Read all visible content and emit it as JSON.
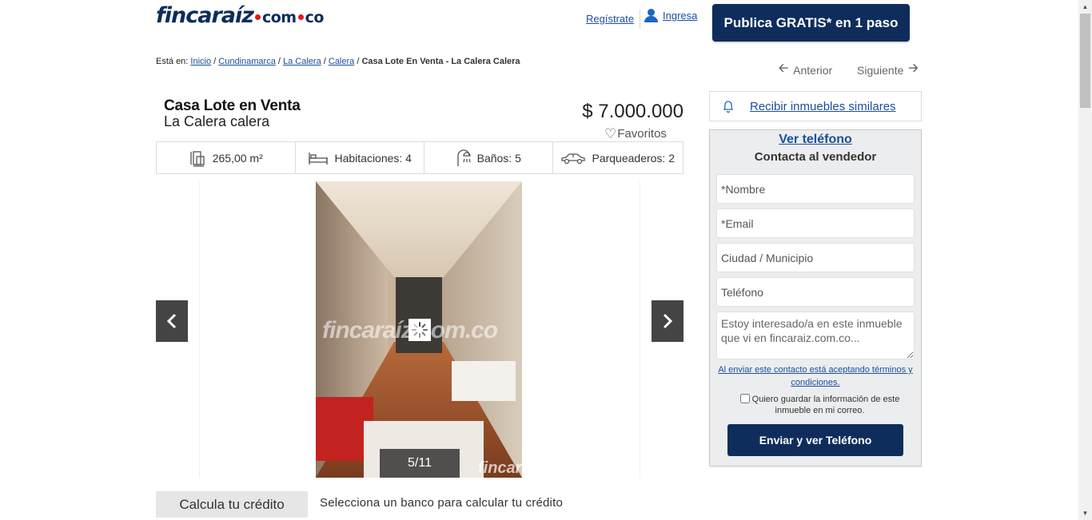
{
  "header": {
    "logo_main": "fincaraíz",
    "logo_com": "com",
    "logo_co": "co",
    "register": "Regístrate",
    "login": "Ingresa",
    "publish": "Publica GRATIS* en 1 paso"
  },
  "breadcrumb": {
    "prefix": "Está en:",
    "items": [
      "Inicio",
      "Cundinamarca",
      "La Calera",
      "Calera"
    ],
    "current": "Casa Lote En Venta - La Calera Calera"
  },
  "nav": {
    "prev": "Anterior",
    "next": "Siguiente"
  },
  "listing": {
    "title": "Casa Lote en Venta",
    "subtitle": "La Calera calera",
    "price": "$ 7.000.000",
    "favorites": "Favoritos"
  },
  "features": {
    "area": "265,00 m²",
    "rooms": "Habitaciones: 4",
    "baths": "Baños: 5",
    "parking": "Parqueaderos: 2"
  },
  "gallery": {
    "current": 5,
    "total": 11,
    "counter": "5/11",
    "watermark": "fincaraíz.com.co",
    "watermark_small": "fincaraíz.com.co"
  },
  "credit": {
    "tab": "Calcula tu crédito",
    "text": "Selecciona un banco para calcular tu crédito"
  },
  "sidebar": {
    "similar": "Recibir inmuebles similares",
    "ver_telefono": "Ver teléfono",
    "contact_title": "Contacta al vendedor",
    "placeholders": {
      "nombre": "*Nombre",
      "email": "*Email",
      "ciudad": "Ciudad / Municipio",
      "telefono": "Teléfono",
      "mensaje": "Estoy interesado/a en este inmueble que vi en fincaraiz.com.co..."
    },
    "terms": "Al enviar este contacto está aceptando términos y condiciones.",
    "save_info": "Quiero guardar la información de este inmueble en mi correo.",
    "send": "Enviar y ver Teléfono"
  },
  "colors": {
    "brand_navy": "#0f2d5c",
    "link_blue": "#1a4fa0",
    "brand_red": "#e3161b"
  }
}
